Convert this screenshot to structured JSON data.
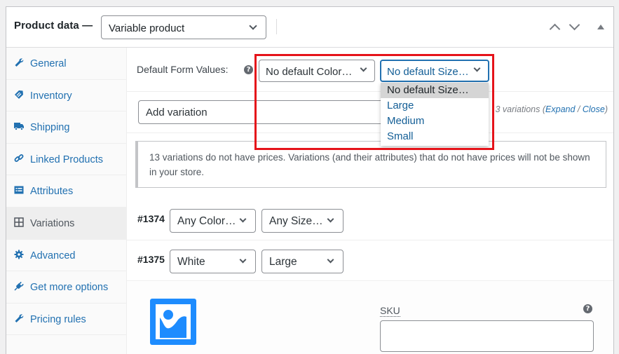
{
  "header": {
    "title": "Product data —",
    "product_type": "Variable product",
    "move_up_icon": "chevron-up-icon",
    "move_down_icon": "chevron-down-icon",
    "toggle_icon": "triangle-up-icon"
  },
  "sidebar": {
    "items": [
      {
        "label": "General",
        "icon": "wrench-icon",
        "active": false
      },
      {
        "label": "Inventory",
        "icon": "tag-icon",
        "active": false
      },
      {
        "label": "Shipping",
        "icon": "truck-icon",
        "active": false
      },
      {
        "label": "Linked Products",
        "icon": "link-icon",
        "active": false
      },
      {
        "label": "Attributes",
        "icon": "list-icon",
        "active": false
      },
      {
        "label": "Variations",
        "icon": "grid-icon",
        "active": true
      },
      {
        "label": "Advanced",
        "icon": "gear-icon",
        "active": false
      },
      {
        "label": "Get more options",
        "icon": "plugin-icon",
        "active": false
      },
      {
        "label": "Pricing rules",
        "icon": "wrench-icon",
        "active": false
      }
    ]
  },
  "default_form": {
    "label": "Default Form Values:",
    "help": "?",
    "color_select": "No default Color…",
    "size_select": "No default Size…",
    "size_options": [
      "No default Size…",
      "Large",
      "Medium",
      "Small"
    ],
    "size_highlighted": "No default Size…"
  },
  "toolbar": {
    "add_variation": "Add variation",
    "count_text": "3 variations",
    "expand": "Expand",
    "separator": " / ",
    "close": "Close"
  },
  "notice": {
    "text": "13 variations do not have prices. Variations (and their attributes) that do not have prices will not be shown in your store."
  },
  "variations": [
    {
      "id": "#1374",
      "color": "Any Color…",
      "size": "Any Size…"
    },
    {
      "id": "#1375",
      "color": "White",
      "size": "Large"
    }
  ],
  "detail": {
    "sku_label": "SKU",
    "sku_value": "",
    "help": "?"
  },
  "colors": {
    "accent": "#2271b1",
    "highlight_border": "#e5131a",
    "image_placeholder": "#1e8cfe"
  }
}
